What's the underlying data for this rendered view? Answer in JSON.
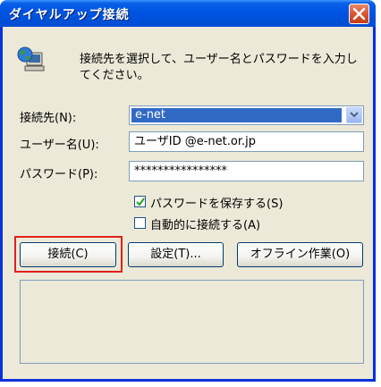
{
  "window": {
    "title": "ダイヤルアップ接続",
    "description": "接続先を選択して、ユーザー名とパスワードを入力してください。"
  },
  "form": {
    "destination_label": "接続先(N):",
    "destination_value": "e-net",
    "username_label": "ユーザー名(U):",
    "username_value": "ユーザID @e-net.or.jp",
    "password_label": "パスワード(P):",
    "password_value": "****************",
    "save_password_label": "パスワードを保存する(S)",
    "save_password_checked": true,
    "auto_connect_label": "自動的に接続する(A)",
    "auto_connect_checked": false
  },
  "buttons": {
    "connect_label": "接続(C)",
    "settings_label": "設定(T)...",
    "offline_label": "オフライン作業(O)"
  },
  "colors": {
    "titlebar": "#0054e3",
    "highlight": "#e0201b",
    "selection": "#316ac5"
  },
  "icons": {
    "app": "dialup-computer-globe-icon",
    "close": "close-icon",
    "dropdown": "chevron-down-icon",
    "check": "checkmark-icon"
  }
}
